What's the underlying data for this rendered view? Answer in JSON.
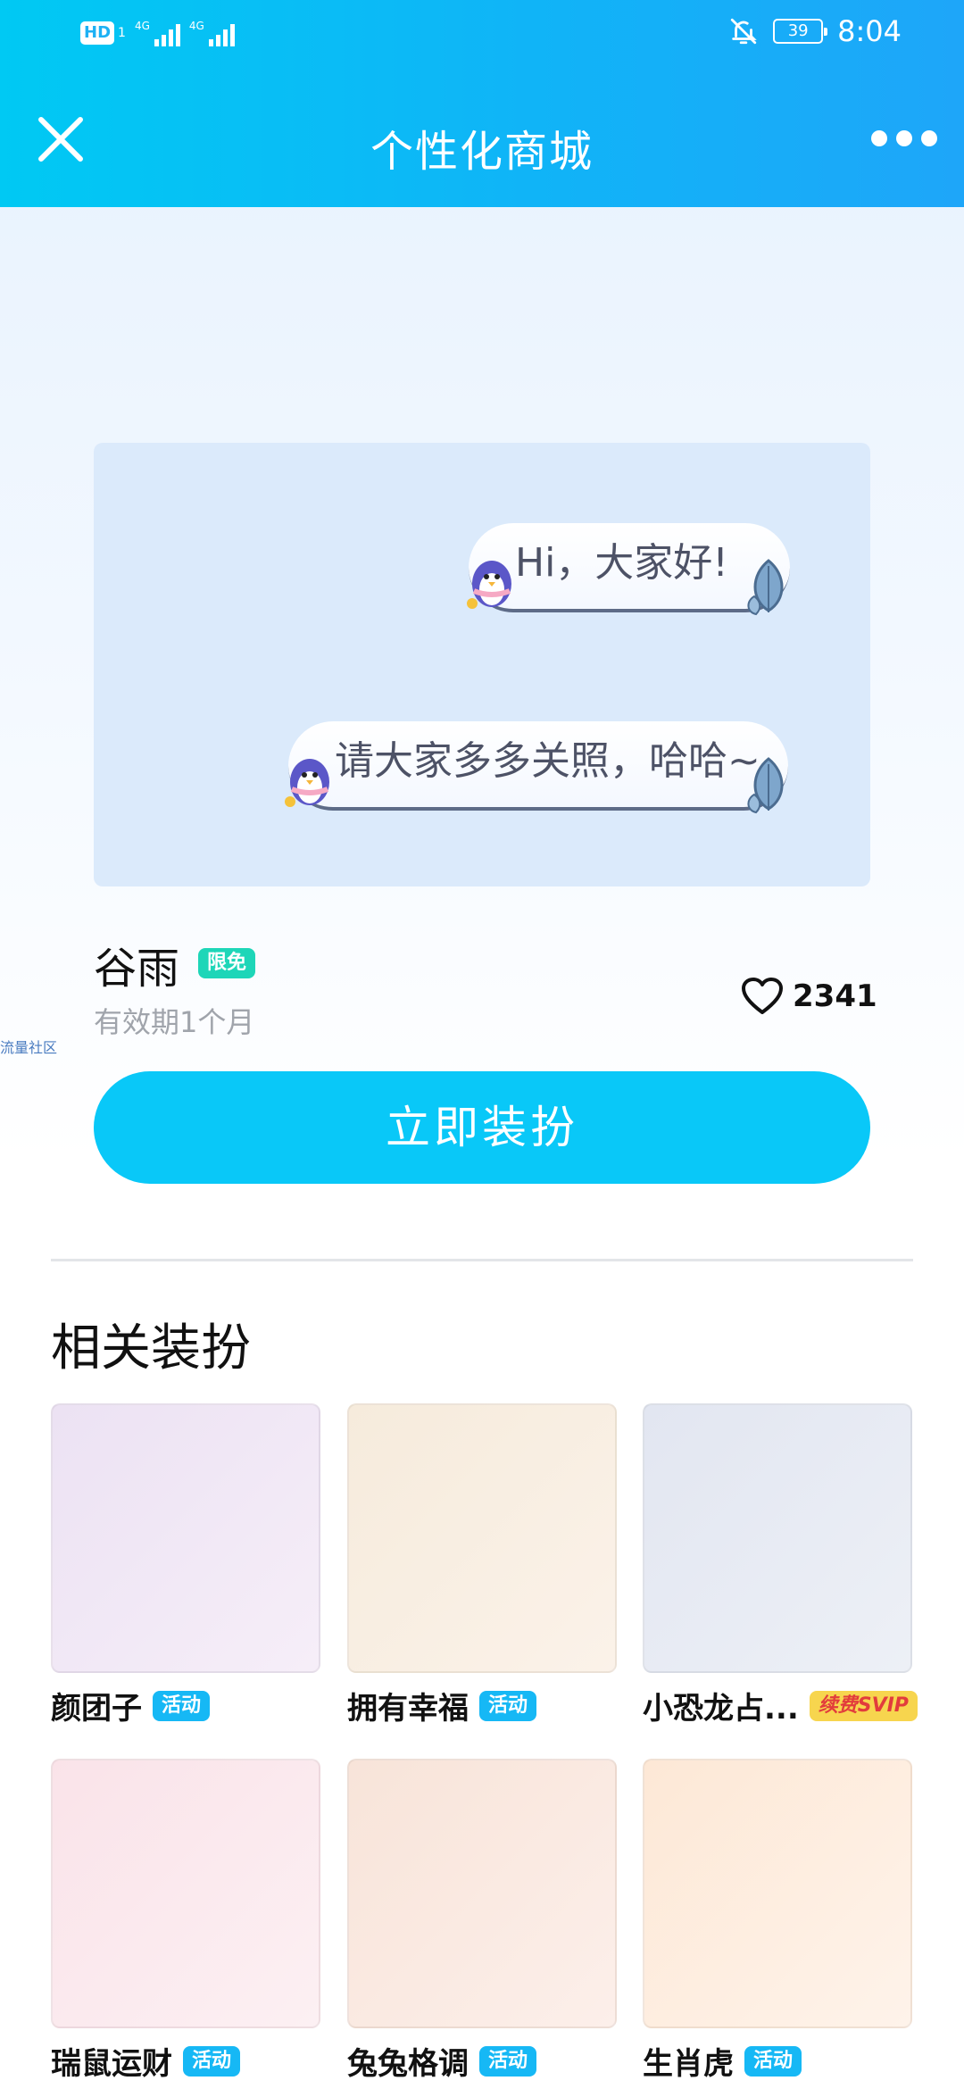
{
  "status_bar": {
    "hd_label": "HD",
    "sim_label": "1",
    "net1": "4G",
    "net2": "4G",
    "battery": "39",
    "time": "8:04"
  },
  "nav": {
    "title": "个性化商城"
  },
  "preview": {
    "bubble1": "Hi，大家好!",
    "bubble2": "请大家多多关照，哈哈~"
  },
  "item": {
    "name": "谷雨",
    "badge": "限免",
    "validity": "有效期1个月",
    "likes": "2341",
    "watermark": "流量社区"
  },
  "cta_label": "立即装扮",
  "related": {
    "title": "相关装扮",
    "items": [
      {
        "name": "颜团子",
        "tag": "活动",
        "color": "#f0e6f5"
      },
      {
        "name": "拥有幸福",
        "tag": "活动",
        "color": "#f8eee2"
      },
      {
        "name": "小恐龙占...",
        "tag": "续费SVIP",
        "color": "#e6eaf3"
      },
      {
        "name": "瑞鼠运财",
        "tag": "活动",
        "color": "#fbe9ee"
      },
      {
        "name": "兔兔格调",
        "tag": "活动",
        "color": "#f9e9e1"
      },
      {
        "name": "生肖虎",
        "tag": "活动",
        "color": "#fdeee0"
      }
    ]
  },
  "colors": {
    "accent": "#09c8f8",
    "header_start": "#00c9f3",
    "header_end": "#1ea6f9",
    "free_badge": "#1ed6b8",
    "activity_badge": "#16b8f5",
    "svip_badge": "#f7d54e"
  }
}
